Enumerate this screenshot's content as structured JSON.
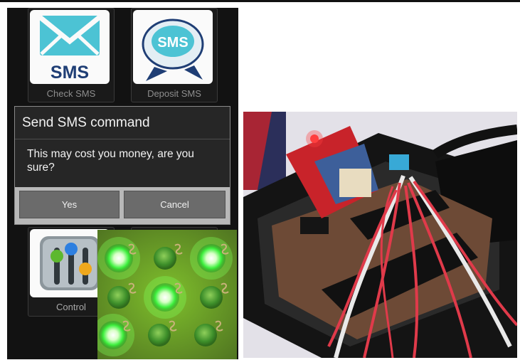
{
  "apps": [
    {
      "label": "Check SMS",
      "icon": "sms-envelope-icon",
      "icon_text": "SMS"
    },
    {
      "label": "Deposit SMS",
      "icon": "sms-speech-bubble-icon",
      "icon_text": "SMS"
    },
    {
      "label": "Control",
      "icon": "control-sliders-icon"
    }
  ],
  "dialog": {
    "title": "Send SMS command",
    "message": "This may cost you money, are you sure?",
    "yes_label": "Yes",
    "cancel_label": "Cancel"
  },
  "led_grid": {
    "rows": 3,
    "cols": 3,
    "lit": [
      true,
      false,
      true,
      false,
      true,
      false,
      true,
      false,
      false
    ]
  },
  "colors": {
    "phone_background": "#121212",
    "dialog_background": "#262626",
    "led_green": "#3df03d",
    "sms_icon_teal": "#4cc3d4",
    "sms_text_navy": "#1f3e75",
    "circuit_board_red": "#c8232a"
  }
}
